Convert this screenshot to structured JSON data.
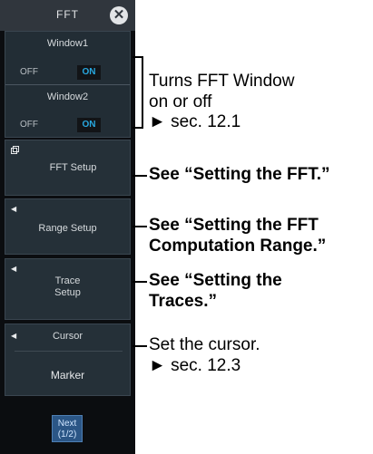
{
  "menu": {
    "title": "FFT",
    "window1_label": "Window1",
    "window2_label": "Window2",
    "off_label": "OFF",
    "on_label": "ON",
    "fft_setup": "FFT Setup",
    "range_setup": "Range Setup",
    "trace_setup_line1": "Trace",
    "trace_setup_line2": "Setup",
    "cursor_label": "Cursor",
    "cursor_value": "Marker",
    "next_line1": "Next",
    "next_line2": "(1/2)",
    "left_arrow": "◀"
  },
  "callouts": {
    "window_line1": "Turns FFT Window",
    "window_line2": "on or off",
    "window_ref": "► sec. 12.1",
    "fft": "See “Setting the FFT.”",
    "range_line1": "See “Setting the FFT",
    "range_line2": "Computation Range.”",
    "traces_line1": "See “Setting the",
    "traces_line2": "Traces.”",
    "cursor_line1": "Set the cursor.",
    "cursor_ref": "► sec. 12.3"
  }
}
